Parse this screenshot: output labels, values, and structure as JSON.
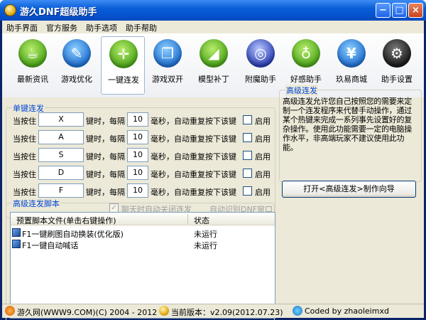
{
  "window": {
    "title": "游久DNF超级助手",
    "min_glyph": "−",
    "max_glyph": "□",
    "close_glyph": "×"
  },
  "menu": [
    "助手界面",
    "官方服务",
    "助手选项",
    "助手帮助"
  ],
  "toolbar": [
    {
      "label": "最新资讯",
      "icon": "cup-icon",
      "glyph": "☕"
    },
    {
      "label": "游戏优化",
      "icon": "scroll-icon",
      "glyph": "✎"
    },
    {
      "label": "一键连发",
      "icon": "gamepad-icon",
      "glyph": "✛"
    },
    {
      "label": "游戏双开",
      "icon": "windows-icon",
      "glyph": "❐"
    },
    {
      "label": "模型补丁",
      "icon": "ruler-icon",
      "glyph": "◢"
    },
    {
      "label": "附魔助手",
      "icon": "globe-icon",
      "glyph": "◎"
    },
    {
      "label": "好感助手",
      "icon": "glass-icon",
      "glyph": "♁"
    },
    {
      "label": "玖易商城",
      "icon": "yen-icon",
      "glyph": "¥"
    },
    {
      "label": "助手设置",
      "icon": "gear-icon",
      "glyph": "⚙"
    }
  ],
  "single": {
    "title": "单键连发",
    "rows": [
      {
        "pre": "当按住",
        "key": "X",
        "mid": "键时，每隔",
        "interval": "10",
        "post": "毫秒，自动重复按下该键",
        "enable": "启用"
      },
      {
        "pre": "当按住",
        "key": "A",
        "mid": "键时，每隔",
        "interval": "10",
        "post": "毫秒，自动重复按下该键",
        "enable": "启用"
      },
      {
        "pre": "当按住",
        "key": "S",
        "mid": "键时，每隔",
        "interval": "10",
        "post": "毫秒，自动重复按下该键",
        "enable": "启用"
      },
      {
        "pre": "当按住",
        "key": "D",
        "mid": "键时，每隔",
        "interval": "10",
        "post": "毫秒，自动重复按下该键",
        "enable": "启用"
      },
      {
        "pre": "当按住",
        "key": "F",
        "mid": "键时，每隔",
        "interval": "10",
        "post": "毫秒，自动重复按下该键",
        "enable": "启用"
      }
    ],
    "close_on_chat": "聊天时自动关闭连发",
    "detect_window": "自动识别DNF窗口"
  },
  "advanced": {
    "title": "高级连发",
    "description": "高级连发允许您自己按照您的需要来定制一个连发程序来代替手动操作，通过某个热键来完成一系列事先设置好的复杂操作。使用此功能需要一定的电脑操作水平，非高端玩家不建议使用此功能。",
    "wizard_button": "打开<高级连发>制作向导"
  },
  "scripts": {
    "title": "高级连发脚本",
    "columns": [
      "预置脚本文件(单击右键操作)",
      "状态"
    ],
    "rows": [
      {
        "name": "F1一键刷图自动换装(优化版)",
        "state": "未运行"
      },
      {
        "name": "F1一键自动喊话",
        "state": "未运行"
      }
    ]
  },
  "status": {
    "site": "游久网(WWW9.COM)(C) 2004 - 2012",
    "version": "当前版本：v2.09(2012.07.23)",
    "coder": "Coded by zhaoleimxd"
  }
}
